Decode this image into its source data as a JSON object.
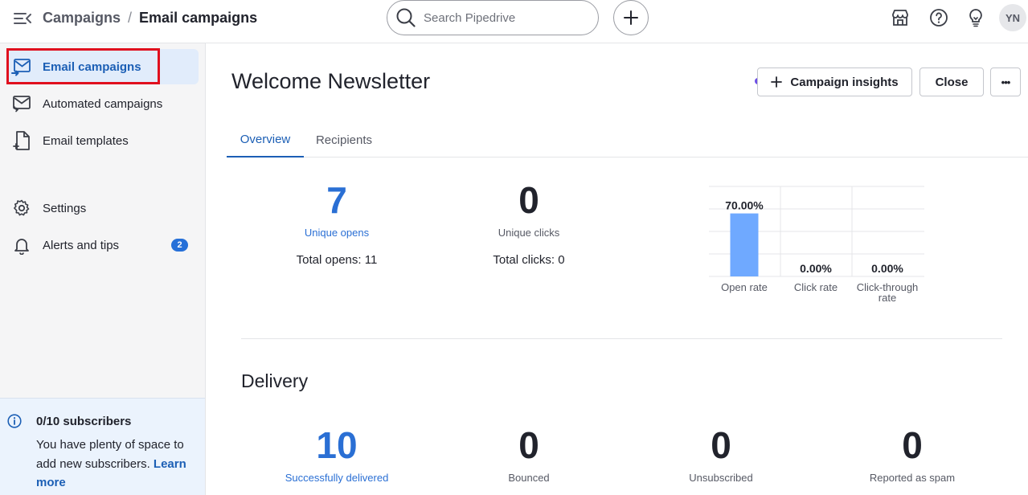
{
  "header": {
    "breadcrumb_parent": "Campaigns",
    "breadcrumb_sep": "/",
    "breadcrumb_current": "Email campaigns",
    "search_placeholder": "Search Pipedrive",
    "avatar_initials": "YN"
  },
  "sidebar": {
    "items": [
      {
        "label": "Email campaigns",
        "icon": "mail-icon",
        "active": true
      },
      {
        "label": "Automated campaigns",
        "icon": "automation-mail-icon"
      },
      {
        "label": "Email templates",
        "icon": "template-icon"
      },
      {
        "label": "Settings",
        "icon": "gear-icon"
      },
      {
        "label": "Alerts and tips",
        "icon": "bell-icon",
        "badge": "2"
      }
    ],
    "subscribers": {
      "title": "0/10 subscribers",
      "text": "You have plenty of space to add new subscribers.",
      "link": "Learn more"
    }
  },
  "main": {
    "title": "Welcome Newsletter",
    "buttons": {
      "insights": "Campaign insights",
      "close": "Close",
      "more": "•••"
    },
    "tabs": [
      {
        "label": "Overview",
        "active": true
      },
      {
        "label": "Recipients"
      }
    ],
    "engagement": {
      "opens": {
        "value": "7",
        "label": "Unique opens",
        "total": "Total opens: 11"
      },
      "clicks": {
        "value": "0",
        "label": "Unique clicks",
        "total": "Total clicks: 0"
      }
    },
    "delivery": {
      "title": "Delivery",
      "metrics": [
        {
          "value": "10",
          "label": "Successfully delivered"
        },
        {
          "value": "0",
          "label": "Bounced"
        },
        {
          "value": "0",
          "label": "Unsubscribed"
        },
        {
          "value": "0",
          "label": "Reported as spam"
        }
      ]
    }
  },
  "chart_data": {
    "type": "bar",
    "categories": [
      "Open rate",
      "Click rate",
      "Click-through rate"
    ],
    "values": [
      70,
      0,
      0
    ],
    "data_labels": [
      "70.00%",
      "0.00%",
      "0.00%"
    ],
    "ylim": [
      0,
      100
    ],
    "grid": true,
    "bar_color": "#6fa9ff"
  },
  "colors": {
    "accent": "#1c5fb5",
    "metric_blue": "#2a6fd4",
    "highlight": "#e0101e",
    "dot": "#6d4ee6"
  }
}
